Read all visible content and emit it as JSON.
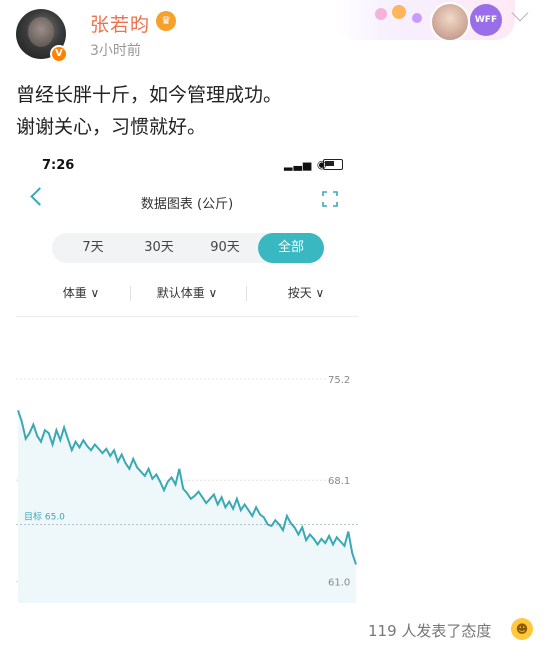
{
  "header": {
    "username": "张若昀",
    "timestamp": "3小时前",
    "verified_label": "V",
    "crown_icon": "crown-icon",
    "banner_badge": "WFF"
  },
  "post": {
    "line1": "曾经长胖十斤，如今管理成功。",
    "line2": "谢谢关心，习惯就好。"
  },
  "phone": {
    "status_time": "7:26",
    "status_icons": "▂▃▅ ◉",
    "nav_title": "数据图表 (公斤)",
    "tabs": [
      "7天",
      "30天",
      "90天",
      "全部"
    ],
    "active_tab": "全部",
    "filters": [
      "体重 ∨",
      "默认体重 ∨",
      "按天 ∨"
    ],
    "accent_color": "#3ab8c2"
  },
  "chart_data": {
    "type": "area",
    "y_ticks": [
      "75.2",
      "68.1",
      "61.0"
    ],
    "target_label": "目标 65.0",
    "target": 65.0,
    "ylim": [
      59.5,
      77.5
    ],
    "series": [
      {
        "values": [
          73.0,
          72.2,
          71.0,
          71.4,
          72.0,
          71.2,
          70.8,
          71.6,
          71.4,
          70.6,
          71.6,
          70.9,
          71.8,
          71.0,
          70.2,
          70.8,
          70.4,
          70.9,
          70.5,
          70.2,
          70.6,
          70.3,
          70.0,
          70.3,
          69.8,
          70.2,
          69.4,
          69.9,
          69.3,
          68.9,
          69.6,
          69.0,
          68.7,
          68.4,
          68.9,
          68.2,
          68.5,
          68.0,
          67.4,
          68.0,
          68.3,
          67.8,
          68.9,
          67.5,
          67.2,
          66.8,
          67.0,
          67.3,
          66.9,
          66.5,
          66.8,
          67.1,
          66.4,
          66.9,
          66.2,
          66.6,
          66.1,
          66.8,
          66.0,
          66.4,
          66.0,
          65.6,
          66.2,
          65.7,
          65.5,
          65.0,
          64.9,
          65.3,
          65.0,
          64.6,
          65.6,
          65.1,
          64.8,
          64.3,
          64.8,
          63.9,
          64.3,
          64.0,
          63.6,
          64.0,
          63.7,
          64.2,
          63.6,
          64.1,
          63.8,
          63.5,
          64.5,
          63.0,
          62.2
        ]
      }
    ]
  },
  "footer": {
    "reactions": "119 人发表了态度",
    "emoji_icon": "grinning-face-icon"
  }
}
